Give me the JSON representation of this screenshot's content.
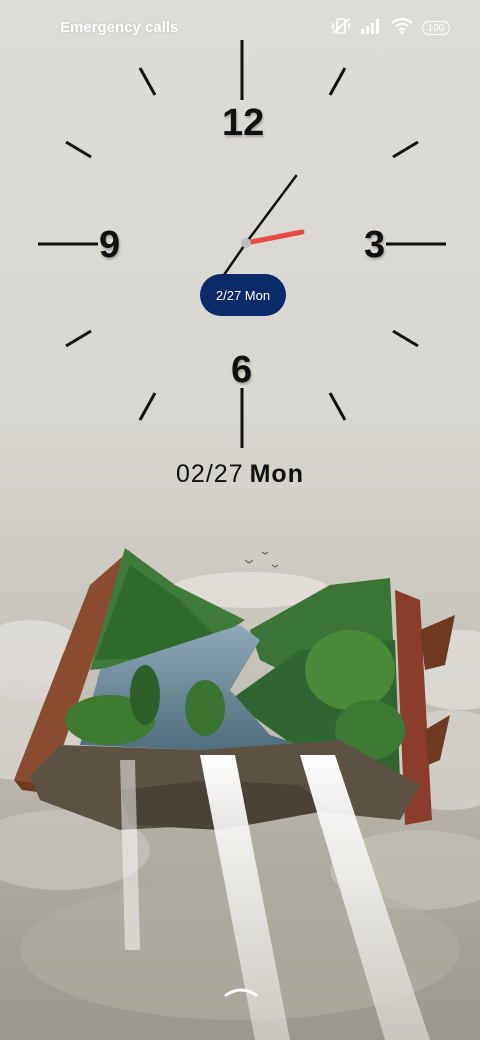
{
  "status_bar": {
    "carrier": "Emergency calls",
    "battery": "100",
    "icons": [
      "vibrate-mute-icon",
      "signal-icon",
      "wifi-icon",
      "battery-icon"
    ]
  },
  "clock": {
    "numerals": {
      "twelve": "12",
      "three": "3",
      "six": "6",
      "nine": "9"
    },
    "pill_date": "2/27 Mon",
    "accent_color": "#e84a4a",
    "pill_color": "#0b2a6a",
    "time_shown": "1:10:17"
  },
  "date_line": {
    "date": "02/27",
    "day": "Mon"
  },
  "wallpaper": {
    "subject": "open book with waterfall landscape above clouds"
  },
  "swipe_hint": "chevron-up-icon"
}
